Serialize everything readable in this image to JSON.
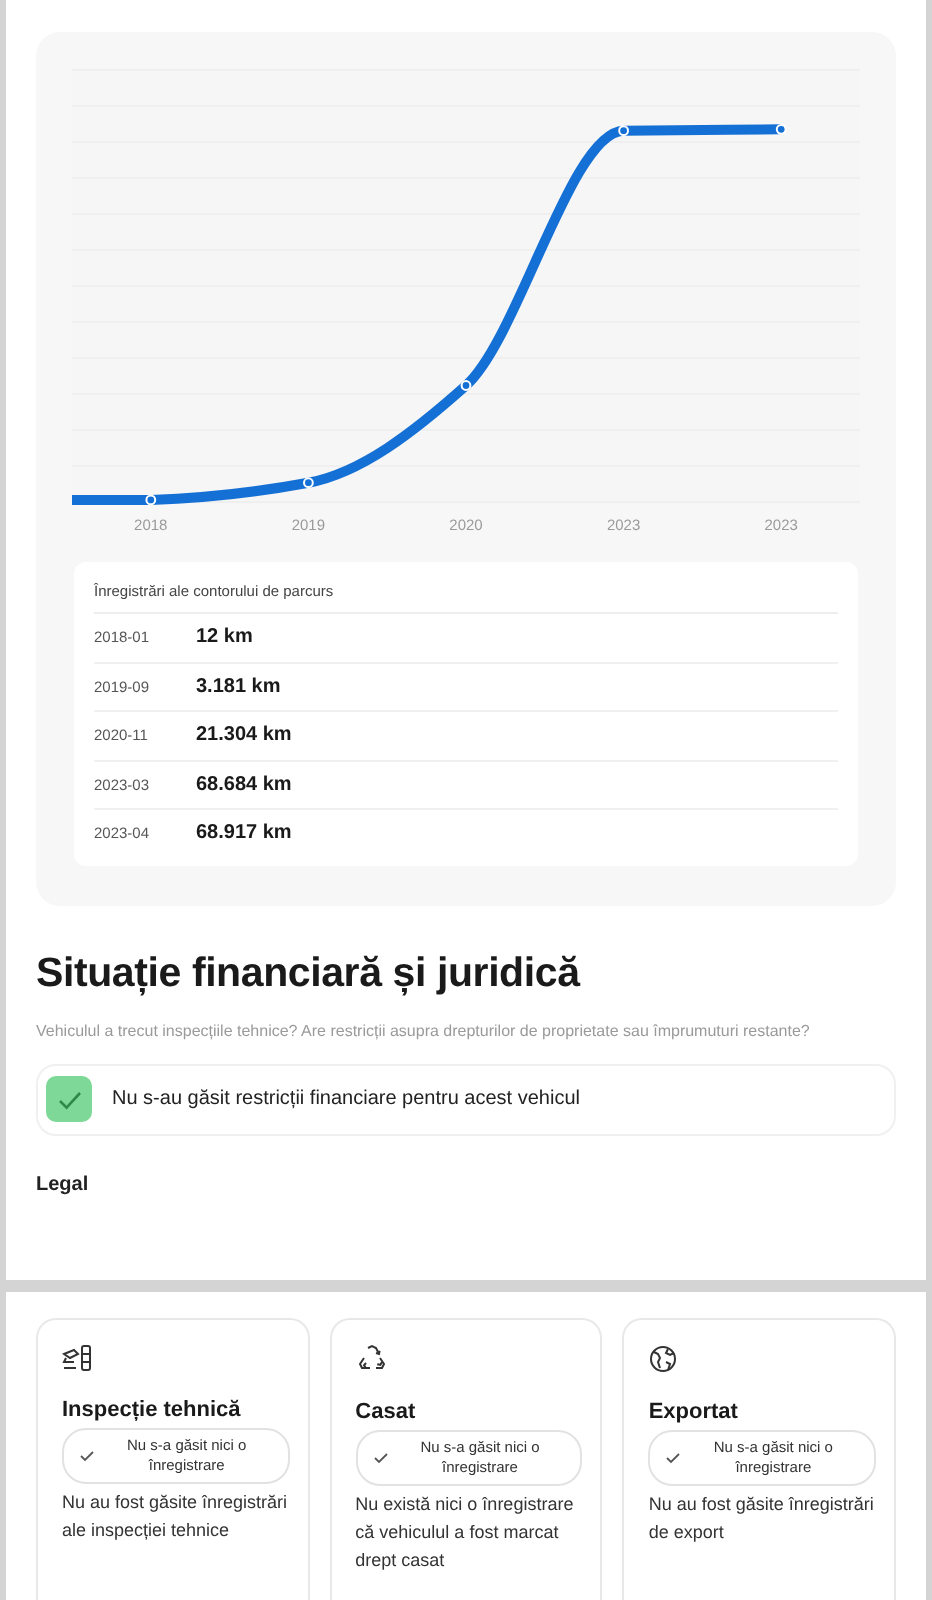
{
  "chart": {
    "x_labels": [
      "2018",
      "2019",
      "2020",
      "2023",
      "2023"
    ]
  },
  "mileage_table": {
    "title": "Înregistrări ale contorului de parcurs",
    "rows": [
      {
        "date": "2018-01",
        "mileage": "12 km"
      },
      {
        "date": "2019-09",
        "mileage": "3.181 km"
      },
      {
        "date": "2020-11",
        "mileage": "21.304 km"
      },
      {
        "date": "2023-03",
        "mileage": "68.684 km"
      },
      {
        "date": "2023-04",
        "mileage": "68.917 km"
      }
    ]
  },
  "financial": {
    "title": "Situație financiară și juridică",
    "subtitle": "Vehiculul a trecut inspecțiile tehnice? Are restricții asupra drepturilor de proprietate sau împrumuturi restante?",
    "alert": {
      "passed": true,
      "text": "Nu s-au găsit restricții financiare pentru acest vehicul"
    },
    "legal_label": "Legal"
  },
  "checks": [
    {
      "kind": "inspection",
      "title": "Inspecție tehnică",
      "badge": "Nu s-a găsit nici o înregistrare",
      "description": "Nu au fost găsite înregistrări ale inspecției tehnice"
    },
    {
      "kind": "scrapped",
      "title": "Casat",
      "badge": "Nu s-a găsit nici o înregistrare",
      "description": "Nu există nici o înregistrare că vehiculul a fost marcat drept casat"
    },
    {
      "kind": "export",
      "title": "Exportat",
      "badge": "Nu s-a găsit nici o înregistrare",
      "description": "Nu au fost găsite înregistrări de export"
    }
  ]
}
